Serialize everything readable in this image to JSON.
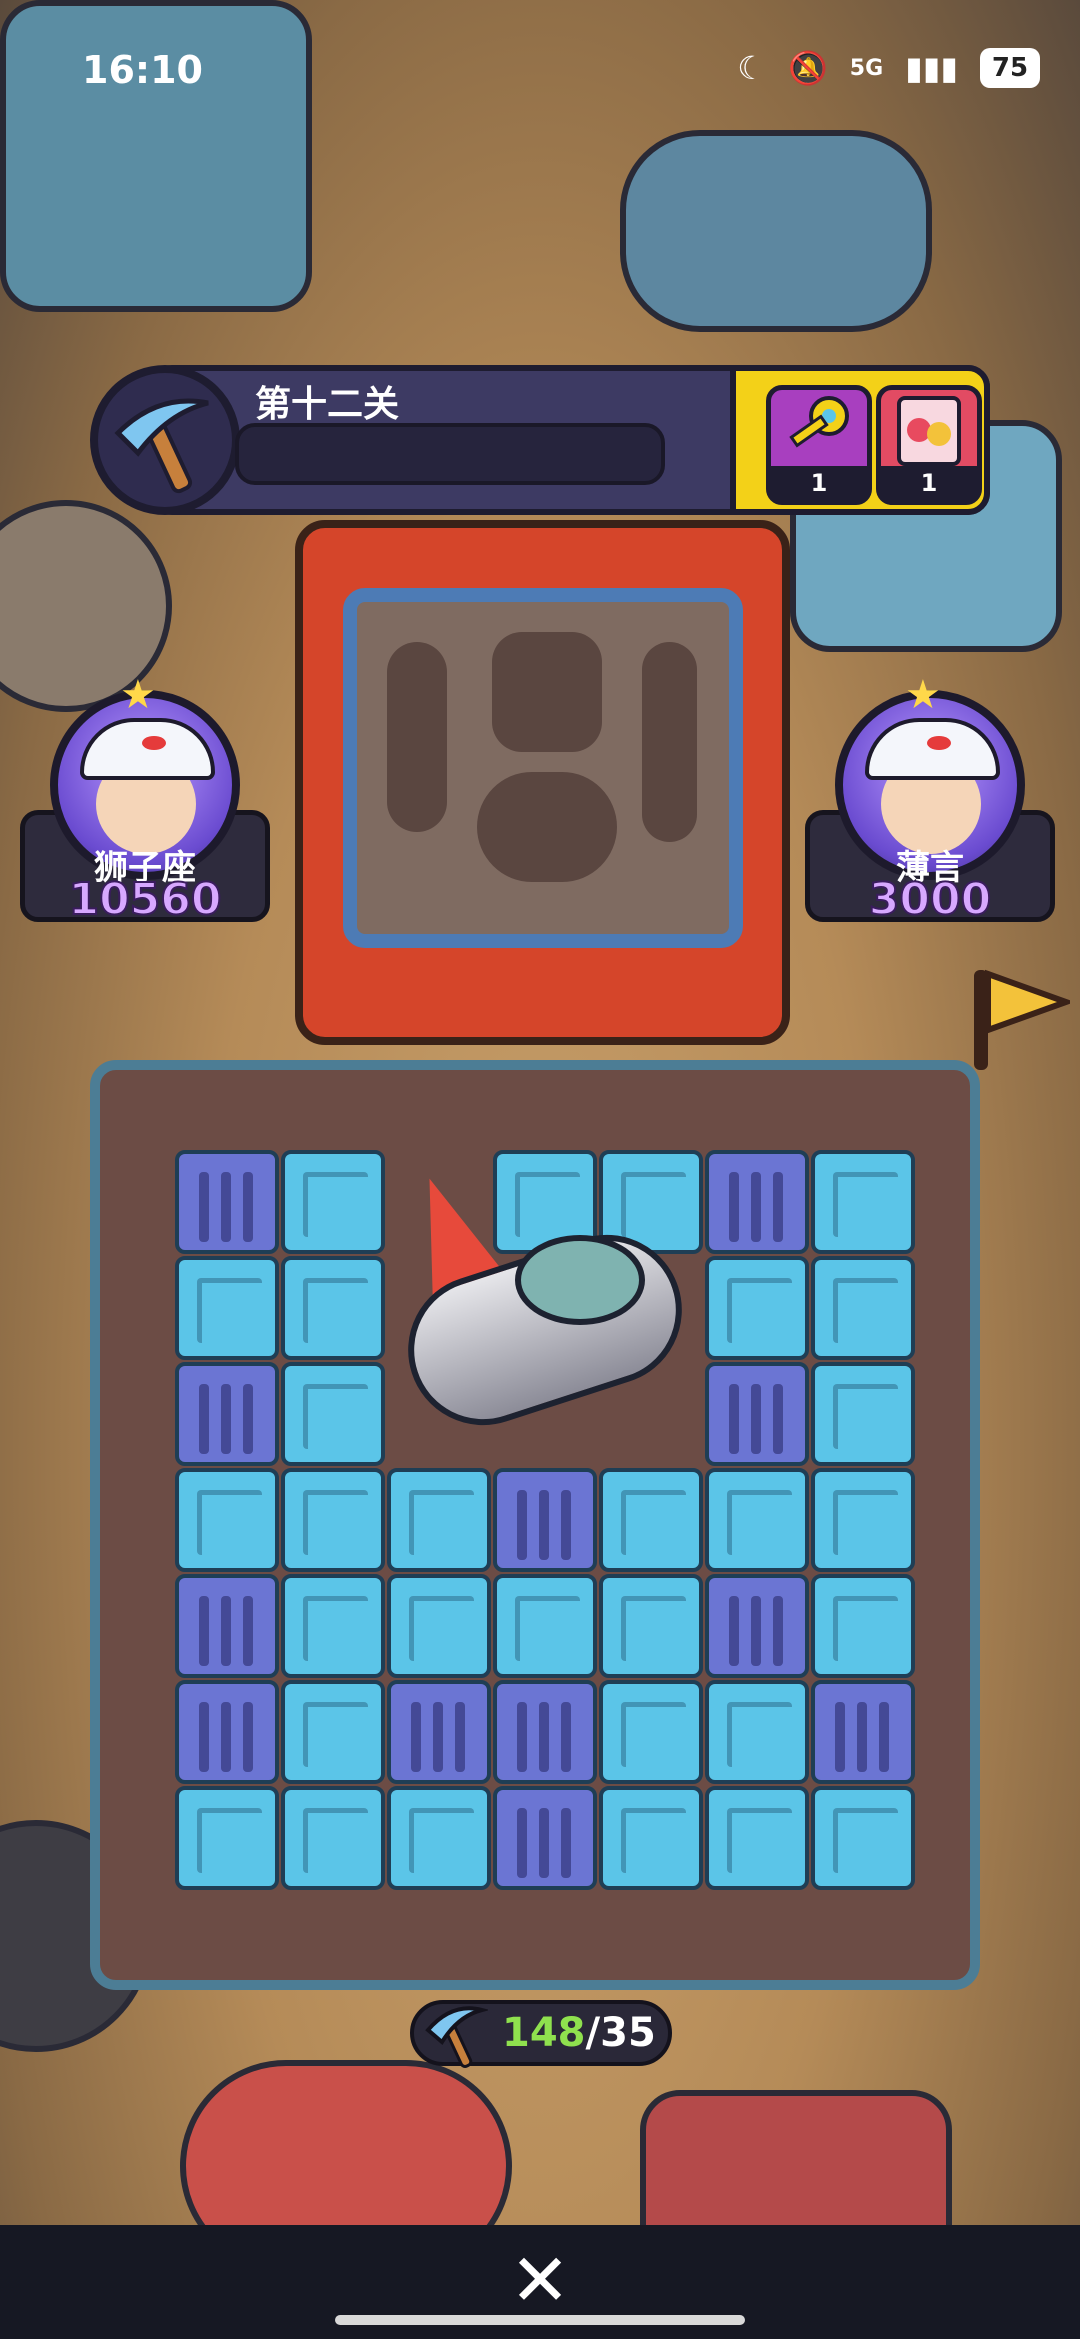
{
  "status_bar": {
    "time": "16:10",
    "network": "5G",
    "battery": "75",
    "icons": [
      "moon-icon",
      "mute-icon",
      "signal-icon",
      "battery-icon"
    ]
  },
  "level": {
    "title": "第十二关",
    "progress": 0,
    "items": [
      {
        "icon": "key-icon",
        "count": "1"
      },
      {
        "icon": "card-pack-icon",
        "count": "1"
      }
    ]
  },
  "players": {
    "left": {
      "name": "狮子座",
      "score": "10560"
    },
    "right": {
      "name": "薄言",
      "score": "3000"
    }
  },
  "board": {
    "rows": [
      [
        "dark",
        "blue",
        "empty",
        "blue",
        "blue",
        "dark",
        "blue"
      ],
      [
        "blue",
        "blue",
        "empty",
        "empty",
        "empty",
        "blue",
        "blue"
      ],
      [
        "dark",
        "blue",
        "empty",
        "empty",
        "empty",
        "dark",
        "blue"
      ],
      [
        "blue",
        "blue",
        "blue",
        "dark",
        "blue",
        "blue",
        "blue"
      ],
      [
        "dark",
        "blue",
        "blue",
        "blue",
        "blue",
        "dark",
        "blue"
      ],
      [
        "dark",
        "blue",
        "dark",
        "dark",
        "blue",
        "blue",
        "dark"
      ],
      [
        "blue",
        "blue",
        "blue",
        "dark",
        "blue",
        "blue",
        "blue"
      ]
    ]
  },
  "pickaxe_counter": {
    "current": "148",
    "separator": "/",
    "total": "35"
  },
  "controls": {
    "close_icon": "close-icon"
  },
  "colors": {
    "header": "#3d3a63",
    "accent_yellow": "#f3d118",
    "tile_blue": "#5bc5e8",
    "tile_dark": "#6b75d3"
  }
}
